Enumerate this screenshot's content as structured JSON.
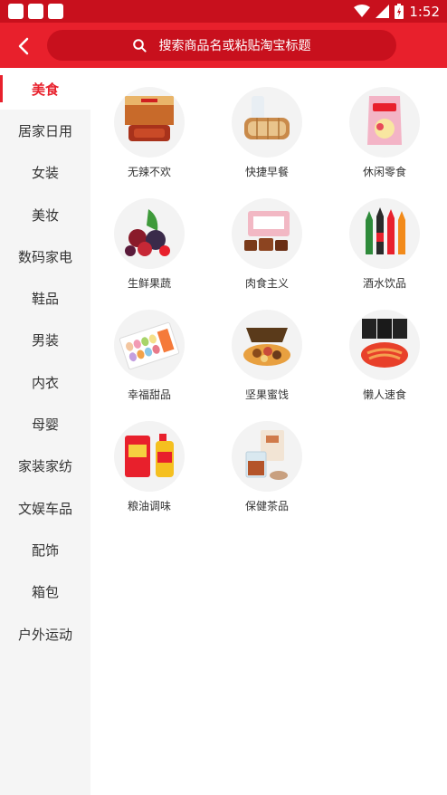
{
  "status_bar": {
    "time": "1:52",
    "icons": [
      "notification-square-icon",
      "notification-square-icon",
      "notification-square-icon",
      "wifi-icon",
      "signal-icon",
      "battery-icon"
    ]
  },
  "header": {
    "search_placeholder": "搜索商品名或粘贴淘宝标题",
    "accent": "#e8202c",
    "status_color": "#c8101d"
  },
  "sidebar": {
    "items": [
      {
        "label": "美食",
        "active": true
      },
      {
        "label": "居家日用"
      },
      {
        "label": "女装"
      },
      {
        "label": "美妆"
      },
      {
        "label": "数码家电"
      },
      {
        "label": "鞋品"
      },
      {
        "label": "男装"
      },
      {
        "label": "内衣"
      },
      {
        "label": "母婴"
      },
      {
        "label": "家装家纺"
      },
      {
        "label": "文娱车品"
      },
      {
        "label": "配饰"
      },
      {
        "label": "箱包"
      },
      {
        "label": "户外运动"
      }
    ]
  },
  "categories": [
    {
      "label": "无辣不欢",
      "icon": "spicy-snack-icon"
    },
    {
      "label": "快捷早餐",
      "icon": "bread-milk-icon"
    },
    {
      "label": "休闲零食",
      "icon": "chips-bag-icon"
    },
    {
      "label": "生鲜果蔬",
      "icon": "berries-icon"
    },
    {
      "label": "肉食主义",
      "icon": "braised-meat-icon"
    },
    {
      "label": "酒水饮品",
      "icon": "bottles-icon"
    },
    {
      "label": "幸福甜品",
      "icon": "macaron-box-icon"
    },
    {
      "label": "坚果蜜饯",
      "icon": "nuts-gift-box-icon"
    },
    {
      "label": "懒人速食",
      "icon": "instant-noodles-icon"
    },
    {
      "label": "粮油调味",
      "icon": "rice-oil-icon"
    },
    {
      "label": "保健茶品",
      "icon": "tea-drink-icon"
    }
  ]
}
